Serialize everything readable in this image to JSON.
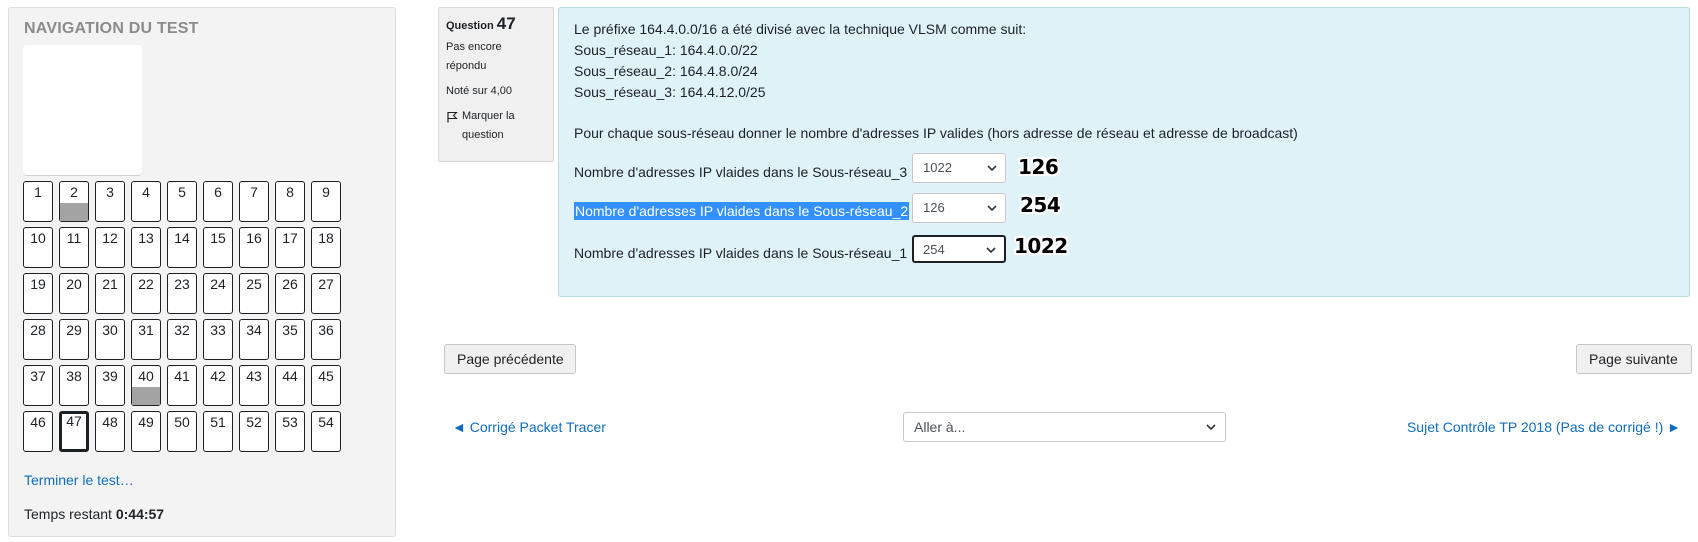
{
  "navigation": {
    "title": "NAVIGATION DU TEST",
    "questions": [
      {
        "n": "1"
      },
      {
        "n": "2",
        "flagged": true
      },
      {
        "n": "3"
      },
      {
        "n": "4"
      },
      {
        "n": "5"
      },
      {
        "n": "6"
      },
      {
        "n": "7"
      },
      {
        "n": "8"
      },
      {
        "n": "9"
      },
      {
        "n": "10"
      },
      {
        "n": "11"
      },
      {
        "n": "12"
      },
      {
        "n": "13"
      },
      {
        "n": "14"
      },
      {
        "n": "15"
      },
      {
        "n": "16"
      },
      {
        "n": "17"
      },
      {
        "n": "18"
      },
      {
        "n": "19"
      },
      {
        "n": "20"
      },
      {
        "n": "21"
      },
      {
        "n": "22"
      },
      {
        "n": "23"
      },
      {
        "n": "24"
      },
      {
        "n": "25"
      },
      {
        "n": "26"
      },
      {
        "n": "27"
      },
      {
        "n": "28"
      },
      {
        "n": "29"
      },
      {
        "n": "30"
      },
      {
        "n": "31"
      },
      {
        "n": "32"
      },
      {
        "n": "33"
      },
      {
        "n": "34"
      },
      {
        "n": "35"
      },
      {
        "n": "36"
      },
      {
        "n": "37"
      },
      {
        "n": "38"
      },
      {
        "n": "39"
      },
      {
        "n": "40",
        "flagged": true
      },
      {
        "n": "41"
      },
      {
        "n": "42"
      },
      {
        "n": "43"
      },
      {
        "n": "44"
      },
      {
        "n": "45"
      },
      {
        "n": "46"
      },
      {
        "n": "47",
        "current": true
      },
      {
        "n": "48"
      },
      {
        "n": "49"
      },
      {
        "n": "50"
      },
      {
        "n": "51"
      },
      {
        "n": "52"
      },
      {
        "n": "53"
      },
      {
        "n": "54"
      }
    ],
    "finish_link": "Terminer le test…",
    "timer_label": "Temps restant",
    "timer_value": "0:44:57"
  },
  "question_info": {
    "label": "Question",
    "number": "47",
    "state_line1": "Pas encore",
    "state_line2": "répondu",
    "grade": "Noté sur 4,00",
    "flag_line1": "Marquer la",
    "flag_line2": "question",
    "flag_icon": "flag-outline-icon"
  },
  "question": {
    "intro": "Le préfixe 164.4.0.0/16 a été divisé avec la technique VLSM comme suit:",
    "subnets": [
      "Sous_réseau_1: 164.4.0.0/22",
      "Sous_réseau_2: 164.4.8.0/24",
      "Sous_réseau_3: 164.4.12.0/25"
    ],
    "ask": "Pour chaque sous-réseau donner le nombre d'adresses IP valides (hors adresse de réseau et adresse de broadcast)",
    "rows": [
      {
        "label": "Nombre d'adresses IP vlaides dans le Sous-réseau_3",
        "value": "1022",
        "annotation": "126"
      },
      {
        "label": "Nombre d'adresses IP vlaides dans le Sous-réseau_2",
        "value": "126",
        "annotation": "254",
        "selected": true
      },
      {
        "label": "Nombre d'adresses IP vlaides dans le Sous-réseau_1",
        "value": "254",
        "annotation": "1022",
        "focused": true
      }
    ]
  },
  "page_nav": {
    "prev_label": "Page précédente",
    "next_label": "Page suivante"
  },
  "activity_nav": {
    "prev_link": "◄ Corrigé Packet Tracer",
    "jump_placeholder": "Aller à...",
    "next_link": "Sujet Contrôle TP 2018 (Pas de corrigé !) ►"
  },
  "colors": {
    "link": "#0f6cbf",
    "question_bg": "#def2f8",
    "selection": "#3390ff"
  }
}
